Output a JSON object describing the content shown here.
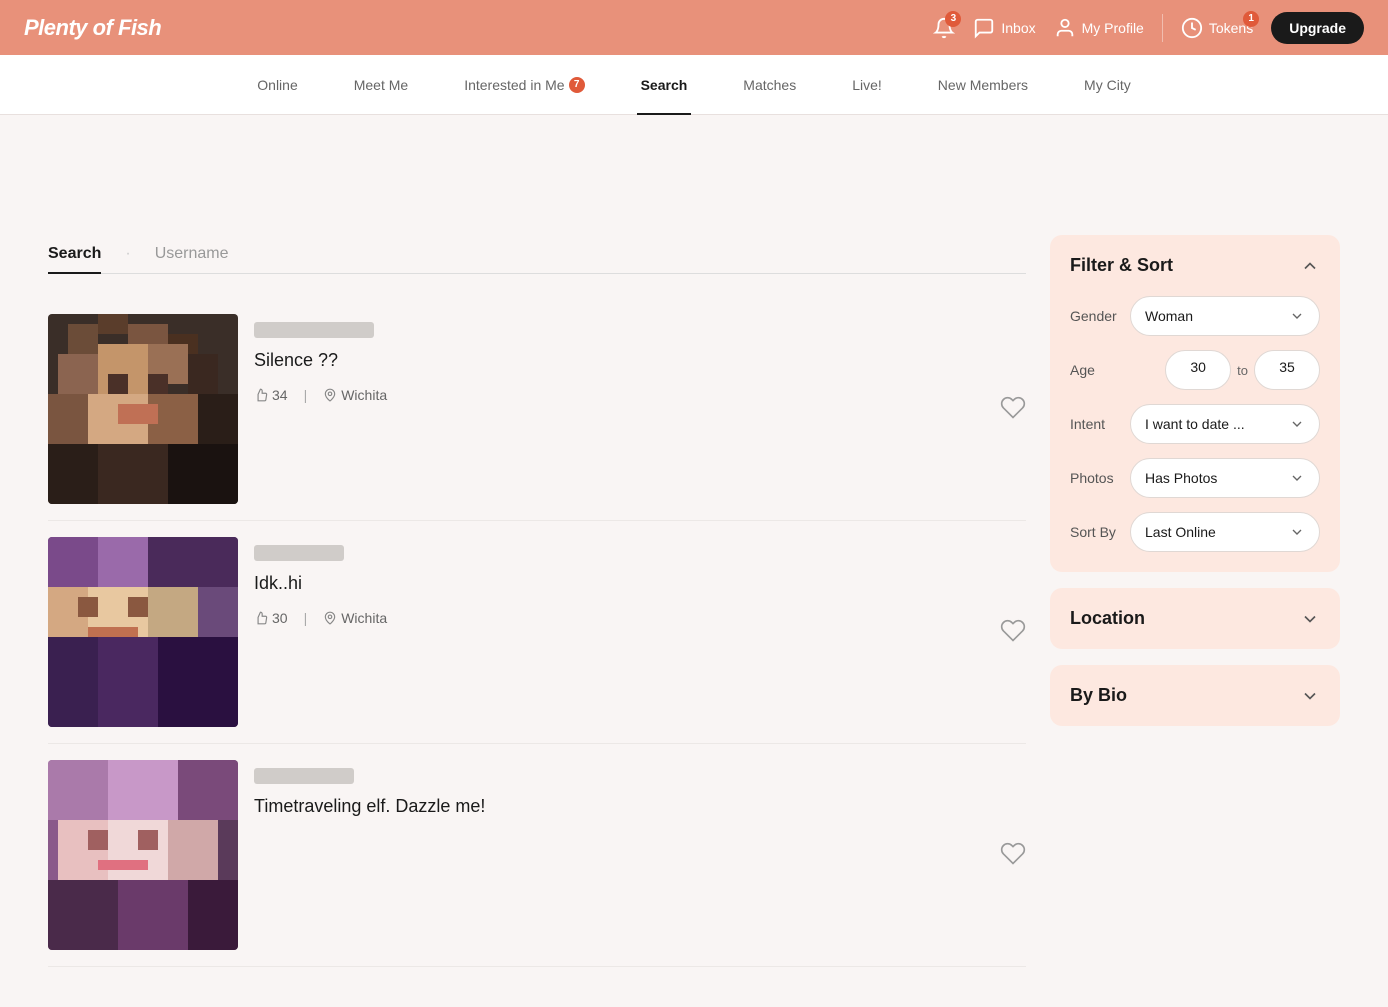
{
  "brand": "Plenty of Fish",
  "header": {
    "notifications_count": "3",
    "inbox_label": "Inbox",
    "profile_label": "My Profile",
    "tokens_label": "Tokens",
    "tokens_count": "1",
    "upgrade_label": "Upgrade"
  },
  "nav": {
    "items": [
      {
        "label": "Online",
        "active": false,
        "badge": null
      },
      {
        "label": "Meet Me",
        "active": false,
        "badge": null
      },
      {
        "label": "Interested in Me",
        "active": false,
        "badge": "7"
      },
      {
        "label": "Search",
        "active": true,
        "badge": null
      },
      {
        "label": "Matches",
        "active": false,
        "badge": null
      },
      {
        "label": "Live!",
        "active": false,
        "badge": null
      },
      {
        "label": "New Members",
        "active": false,
        "badge": null
      },
      {
        "label": "My City",
        "active": false,
        "badge": null
      }
    ]
  },
  "search_tabs": [
    {
      "label": "Search",
      "active": true
    },
    {
      "label": "Username",
      "active": false
    }
  ],
  "profiles": [
    {
      "name": "Silence ??",
      "age": "34",
      "city": "Wichita"
    },
    {
      "name": "Idk..hi",
      "age": "30",
      "city": "Wichita"
    },
    {
      "name": "Timetraveling elf. Dazzle me!",
      "age": "",
      "city": ""
    }
  ],
  "filter": {
    "title": "Filter & Sort",
    "gender_label": "Gender",
    "gender_value": "Woman",
    "age_label": "Age",
    "age_from": "30",
    "age_to": "35",
    "age_separator": "to",
    "intent_label": "Intent",
    "intent_value": "I want to date ...",
    "photos_label": "Photos",
    "photos_value": "Has Photos",
    "sort_label": "Sort By",
    "sort_value": "Last Online"
  },
  "location": {
    "title": "Location"
  },
  "bio": {
    "title": "By Bio"
  }
}
